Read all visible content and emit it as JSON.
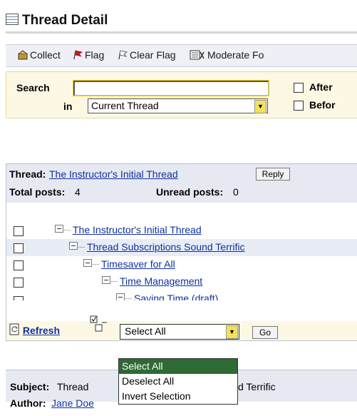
{
  "page": {
    "title": "Thread Detail"
  },
  "toolbar": {
    "collect": "Collect",
    "flag": "Flag",
    "clear_flag": "Clear Flag",
    "moderate": "Moderate Fo"
  },
  "search": {
    "label": "Search",
    "value": "",
    "in_label": "in",
    "scope_value": "Current Thread",
    "after_label": "After",
    "before_label": "Befor"
  },
  "thread": {
    "label": "Thread:",
    "title": "The Instructor's Initial Thread",
    "reply_label": "Reply",
    "total_posts_label": "Total posts:",
    "total_posts": "4",
    "unread_posts_label": "Unread posts:",
    "unread_posts": "0",
    "posts": [
      {
        "title": "The Instructor's Initial Thread",
        "level": 0
      },
      {
        "title": "Thread Subscriptions Sound Terrific",
        "level": 1
      },
      {
        "title": "Timesaver for All",
        "level": 2
      },
      {
        "title": "Time Management",
        "level": 3
      },
      {
        "title": "Saving Time (draft)",
        "level": 4
      }
    ]
  },
  "footer": {
    "refresh_label": "Refresh",
    "select_value": "Select All",
    "go_label": "Go"
  },
  "dropdown": {
    "options": [
      "Select All",
      "Deselect All",
      "Invert Selection"
    ],
    "selected": "Select All"
  },
  "message": {
    "subject_label": "Subject:",
    "subject_start": "Thread",
    "subject_end": "d Terrific",
    "author_label": "Author:",
    "author": "Jane Doe"
  },
  "colors": {
    "link": "#1030a0",
    "toolbar_bg": "#eef0f6",
    "search_bg": "#fdf8e4",
    "dropdown_highlight": "#2d6a34"
  }
}
